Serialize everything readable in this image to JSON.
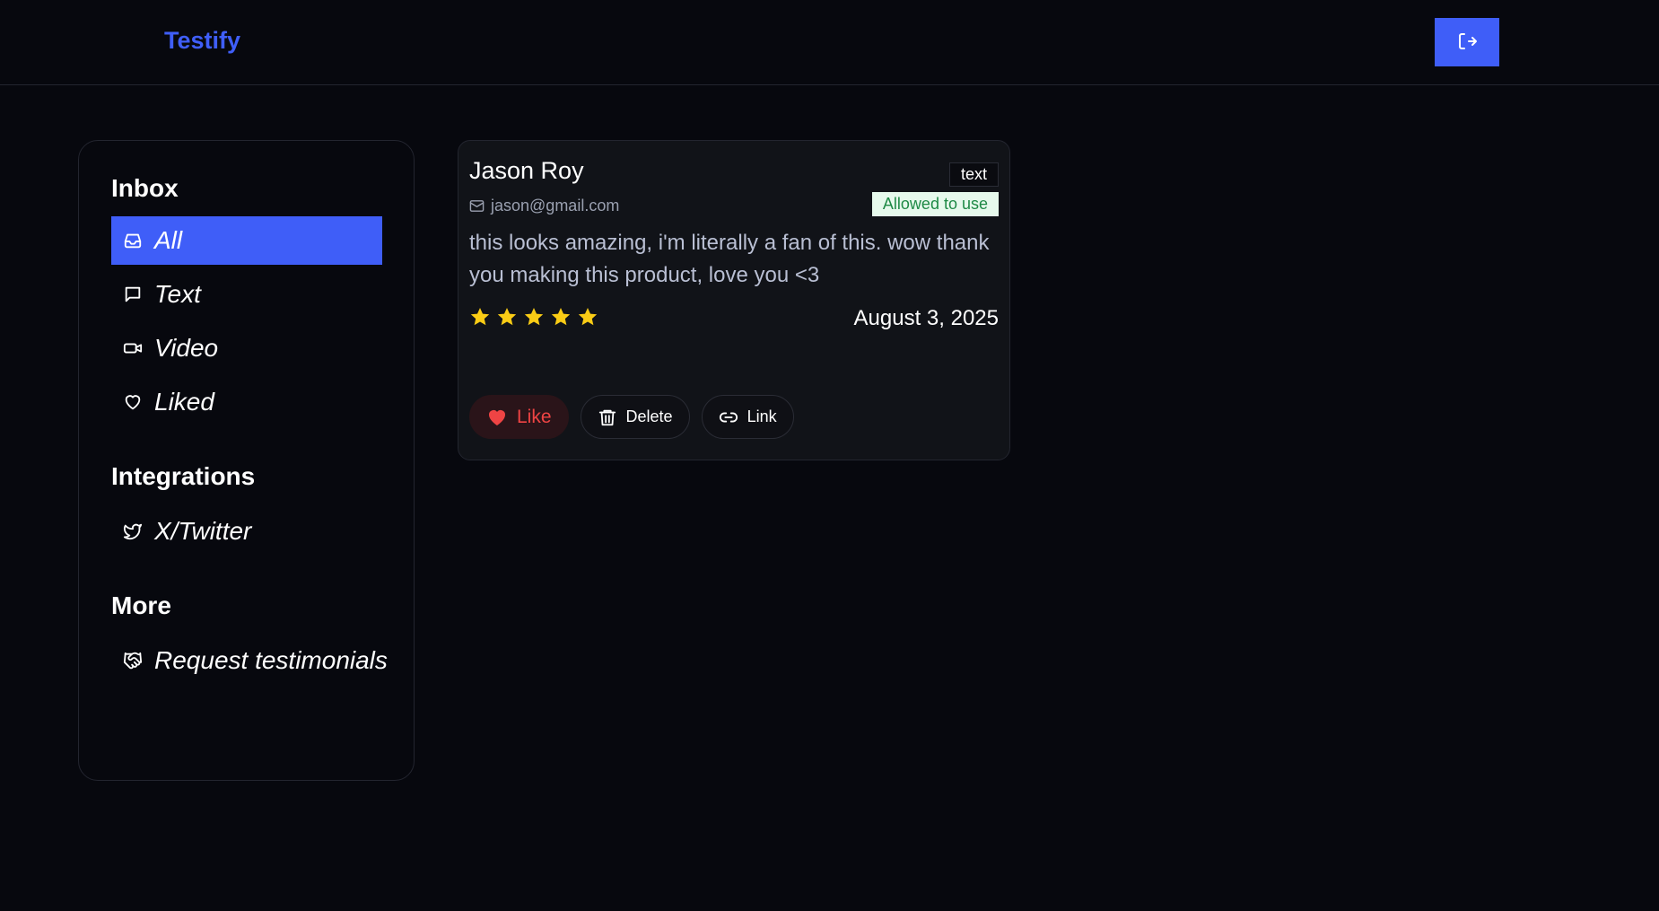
{
  "header": {
    "brand": "Testify",
    "logout_icon": "logout-icon"
  },
  "sidebar": {
    "sections": [
      {
        "title": "Inbox",
        "items": [
          {
            "label": "All",
            "icon": "inbox-icon",
            "active": true
          },
          {
            "label": "Text",
            "icon": "message-square-icon",
            "active": false
          },
          {
            "label": "Video",
            "icon": "video-icon",
            "active": false
          },
          {
            "label": "Liked",
            "icon": "heart-icon",
            "active": false
          }
        ]
      },
      {
        "title": "Integrations",
        "items": [
          {
            "label": "X/Twitter",
            "icon": "twitter-icon",
            "active": false
          }
        ]
      },
      {
        "title": "More",
        "items": [
          {
            "label": "Request testimonials",
            "icon": "handshake-icon",
            "active": false
          }
        ]
      }
    ]
  },
  "testimonial": {
    "name": "Jason Roy",
    "email": "jason@gmail.com",
    "type": "text",
    "permission": "Allowed to use",
    "text": "this looks amazing, i'm literally a fan of this. wow thank you making this product, love you <3",
    "rating": 5,
    "date": "August 3, 2025",
    "actions": {
      "like": "Like",
      "delete": "Delete",
      "link": "Link"
    }
  },
  "colors": {
    "accent": "#3f5ef8",
    "background": "#07080e",
    "card": "#111318",
    "star": "#facc15",
    "like": "#ef4444",
    "allowed_bg": "#e6f9ec",
    "allowed_text": "#1f8a46"
  }
}
